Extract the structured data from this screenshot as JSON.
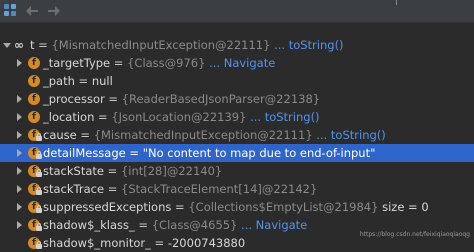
{
  "toolbar": {
    "icons": [
      "layout-grid-icon",
      "back-arrow-icon",
      "forward-arrow-icon"
    ]
  },
  "root": {
    "name": "t",
    "value": "{MismatchedInputException@22111}",
    "link": "... toString()"
  },
  "fields": [
    {
      "name": "_targetType",
      "eq": " = ",
      "value": "{Class@976}",
      "link": " ... Navigate"
    },
    {
      "name": "_path",
      "eq": " = ",
      "value": "null"
    },
    {
      "name": "_processor",
      "eq": " = ",
      "value": "{ReaderBasedJsonParser@22138}"
    },
    {
      "name": "_location",
      "eq": " = ",
      "value": "{JsonLocation@22139}",
      "link": " ... toString()"
    },
    {
      "name": "cause",
      "eq": " = ",
      "value": "{MismatchedInputException@22111}",
      "link": " ... toString()"
    },
    {
      "name": "detailMessage",
      "eq": " = ",
      "value": "\"No content to map due to end-of-input\""
    },
    {
      "name": "stackState",
      "eq": " = ",
      "value": "{int[28]@22140}"
    },
    {
      "name": "stackTrace",
      "eq": " = ",
      "value": "{StackTraceElement[14]@22142}"
    },
    {
      "name": "suppressedExceptions",
      "eq": " = ",
      "value": "{Collections$EmptyList@21984}",
      "extra": "  size = 0"
    },
    {
      "name": "shadow$_klass_",
      "eq": " = ",
      "value": "{Class@4655}",
      "link": " ... Navigate"
    },
    {
      "name": "shadow$_monitor_",
      "eq": " = ",
      "value": "-2000743880"
    }
  ],
  "watermark": "https://blog.csdn.net/feixiqiaoqiaoqg",
  "colors": {
    "background": "#2b2b2b",
    "selection": "#2f65ca",
    "link": "#5394ec",
    "field_badge": "#d68a25"
  }
}
